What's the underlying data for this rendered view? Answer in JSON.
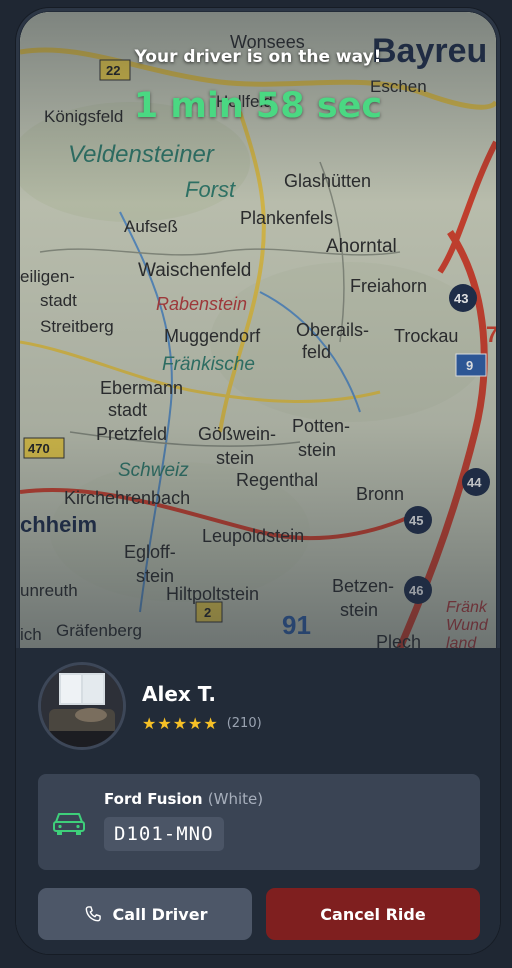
{
  "status": {
    "message": "Your driver is on the way!",
    "eta": "1 min 58 sec"
  },
  "map": {
    "labels": [
      "Wonsees",
      "Bayreu",
      "Königsfeld",
      "Hollfeld",
      "Eschen",
      "Veldensteiner",
      "Forst",
      "Glashütten",
      "Aufseß",
      "Plankenfels",
      "Ahorntal",
      "Waischenfeld",
      "Freiahorn",
      "eiligen-",
      "stadt",
      "Streitberg",
      "Rabenstein",
      "Muggendorf",
      "Oberails-",
      "feld",
      "Trockau",
      "Fränkische",
      "Ebermann",
      "stadt",
      "Pretzfeld",
      "Gößwein-",
      "stein",
      "Potten-",
      "stein",
      "Schweiz",
      "Regenthal",
      "Bronn",
      "Kirchehrenbach",
      "chheim",
      "Leupoldstein",
      "Egloff-",
      "stein",
      "Hiltpoltstein",
      "Betzen-",
      "stein",
      "unreuth",
      "ich",
      "Gräfenberg",
      "Plech",
      "Fränk",
      "Wund",
      "land",
      "22",
      "470",
      "43",
      "9",
      "44",
      "45",
      "46",
      "2",
      "91",
      "7"
    ],
    "colors": {
      "base": "#c9cdb9",
      "road_red": "#d2402c",
      "road_yellow": "#e2c24a",
      "water": "#5a8fc4"
    }
  },
  "driver": {
    "name": "Alex T.",
    "stars": "★★★★★",
    "review_count": "(210)"
  },
  "vehicle": {
    "model": "Ford Fusion",
    "color": "(White)",
    "plate": "D101-MNO",
    "icon": "car-icon"
  },
  "actions": {
    "call_label": "Call Driver",
    "cancel_label": "Cancel Ride"
  },
  "theme": {
    "eta_color": "#4ad882",
    "star_color": "#f6c026",
    "cancel_color": "#7f1f1f",
    "accent_green": "#3ecf7a"
  }
}
